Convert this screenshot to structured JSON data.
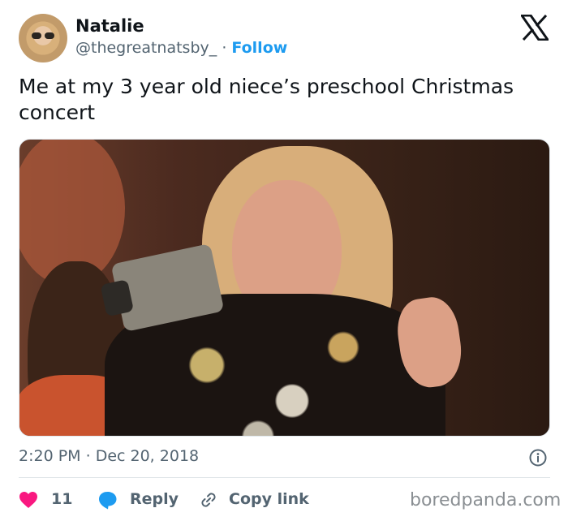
{
  "author": {
    "name": "Natalie",
    "handle": "@thegreatnatsby_",
    "separator": "·",
    "follow_label": "Follow",
    "avatar_icon": "avatar-photo"
  },
  "brand_icon": "x-logo-icon",
  "tweet": {
    "text": "Me at my 3 year old niece’s preschool Christmas concert",
    "media_icon": "photo-woman-filming-with-camcorder"
  },
  "meta": {
    "time": "2:20 PM",
    "separator": "·",
    "date": "Dec 20, 2018"
  },
  "actions": {
    "likes": "11",
    "reply_label": "Reply",
    "copy_link_label": "Copy link"
  },
  "colors": {
    "accent": "#1d9bf0",
    "heart": "#f91880",
    "muted": "#536471"
  },
  "watermark": "boredpanda.com"
}
